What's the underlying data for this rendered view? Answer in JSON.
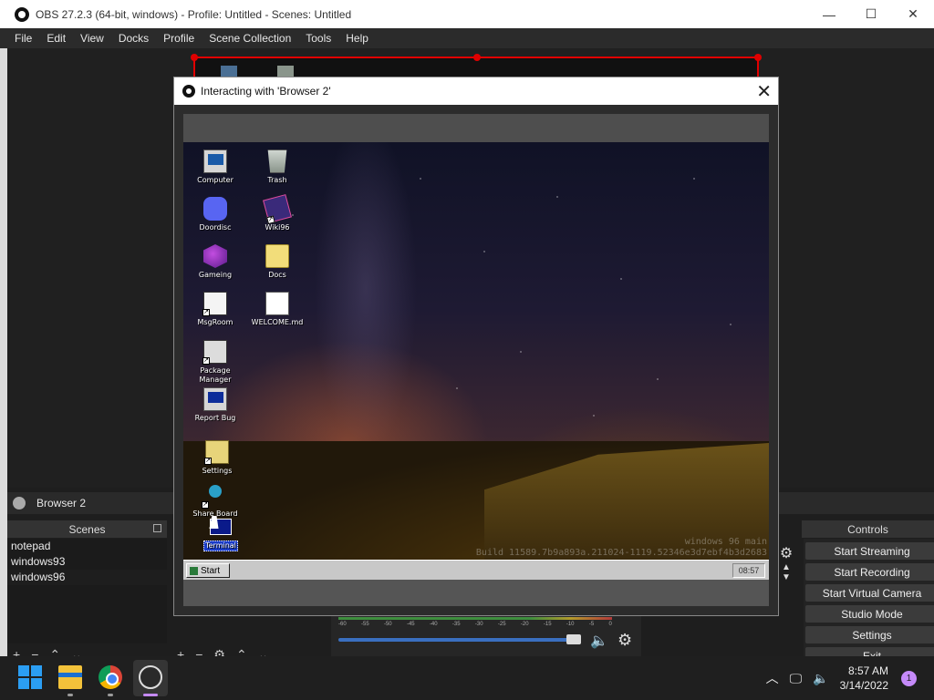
{
  "window": {
    "title": "OBS 27.2.3 (64-bit, windows) - Profile: Untitled - Scenes: Untitled",
    "minimize": "—",
    "maximize": "☐",
    "close": "✕"
  },
  "menu": [
    "File",
    "Edit",
    "View",
    "Docks",
    "Profile",
    "Scene Collection",
    "Tools",
    "Help"
  ],
  "source_bar": {
    "label": "Browser 2"
  },
  "scenes": {
    "header": "Scenes",
    "items": [
      "notepad",
      "windows93",
      "windows96"
    ],
    "selected": "windows96"
  },
  "controls": {
    "header": "Controls",
    "buttons": [
      "Start Streaming",
      "Start Recording",
      "Start Virtual Camera",
      "Studio Mode",
      "Settings",
      "Exit"
    ]
  },
  "mixer": {
    "ticks": [
      "-60",
      "-55",
      "-50",
      "-45",
      "-40",
      "-35",
      "-30",
      "-25",
      "-20",
      "-15",
      "-10",
      "-5",
      "0"
    ]
  },
  "dialog": {
    "title": "Interacting with 'Browser 2'",
    "close": "✕",
    "desktop_icons": [
      {
        "label": "Computer",
        "icon": "computer-icon"
      },
      {
        "label": "Trash",
        "icon": "trash-icon"
      },
      {
        "label": "Doordisc",
        "icon": "discord-icon"
      },
      {
        "label": "Wiki96",
        "icon": "wiki-icon"
      },
      {
        "label": "Gameing",
        "icon": "gaming-icon"
      },
      {
        "label": "Docs",
        "icon": "folder-icon"
      },
      {
        "label": "MsgRoom",
        "icon": "msgroom-icon"
      },
      {
        "label": "WELCOME.md",
        "icon": "document-icon"
      },
      {
        "label": "Package Manager",
        "icon": "package-icon"
      },
      {
        "label": "Report Bug",
        "icon": "bug-report-icon"
      },
      {
        "label": "Settings",
        "icon": "settings-folder-icon"
      },
      {
        "label": "Share Board",
        "icon": "share-icon"
      },
      {
        "label": "Terminal",
        "icon": "terminal-icon"
      }
    ],
    "watermark_line1": "windows 96 main",
    "watermark_line2": "Build 11589.7b9a893a.211024-1119.52346e3d7ebf4b3d2683",
    "start_label": "Start",
    "clock": "08:57"
  },
  "taskbar": {
    "time": "8:57 AM",
    "date": "3/14/2022",
    "notification_count": "1",
    "apps": [
      "start-icon",
      "file-explorer-icon",
      "chrome-icon",
      "obs-icon"
    ]
  }
}
